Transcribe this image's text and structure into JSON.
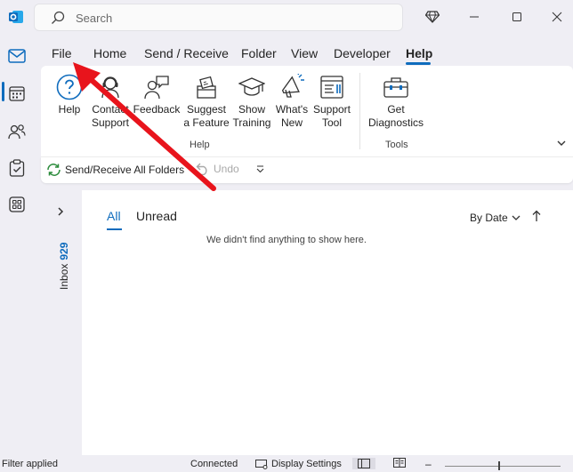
{
  "app": {
    "icon": "outlook-icon"
  },
  "search": {
    "placeholder": "Search"
  },
  "titlebar": {
    "icons": [
      "premium-diamond-icon",
      "minimize-icon",
      "maximize-icon",
      "close-icon"
    ]
  },
  "rail": {
    "items": [
      "mail-icon",
      "calendar-icon",
      "people-icon",
      "tasks-icon",
      "apps-icon"
    ]
  },
  "menu": {
    "tabs": [
      "File",
      "Home",
      "Send / Receive",
      "Folder",
      "View",
      "Developer",
      "Help"
    ],
    "active": "Help"
  },
  "ribbon": {
    "help_group": {
      "label": "Help",
      "buttons": [
        {
          "line1": "Help",
          "line2": "",
          "icon": "help-question-icon"
        },
        {
          "line1": "Contact",
          "line2": "Support",
          "icon": "contact-support-icon"
        },
        {
          "line1": "Feedback",
          "line2": "",
          "icon": "feedback-icon"
        },
        {
          "line1": "Suggest",
          "line2": "a Feature",
          "icon": "suggest-feature-icon"
        },
        {
          "line1": "Show",
          "line2": "Training",
          "icon": "training-icon"
        },
        {
          "line1": "What's",
          "line2": "New",
          "icon": "megaphone-icon"
        },
        {
          "line1": "Support",
          "line2": "Tool",
          "icon": "support-tool-icon"
        }
      ]
    },
    "tools_group": {
      "label": "Tools",
      "buttons": [
        {
          "line1": "Get",
          "line2": "Diagnostics",
          "icon": "diagnostics-toolbox-icon"
        }
      ]
    }
  },
  "qat": {
    "send_receive": "Send/Receive All Folders",
    "undo": "Undo"
  },
  "folder_pane": {
    "inbox_label": "Inbox",
    "inbox_count": "929"
  },
  "message_list": {
    "tabs": [
      "All",
      "Unread"
    ],
    "sort_label": "By Date",
    "empty_text": "We didn't find anything to show here."
  },
  "status_bar": {
    "filter": "Filter applied",
    "connection": "Connected",
    "display_settings": "Display Settings"
  },
  "colors": {
    "accent": "#0f6cbd",
    "annotation_arrow": "#e8141c"
  }
}
